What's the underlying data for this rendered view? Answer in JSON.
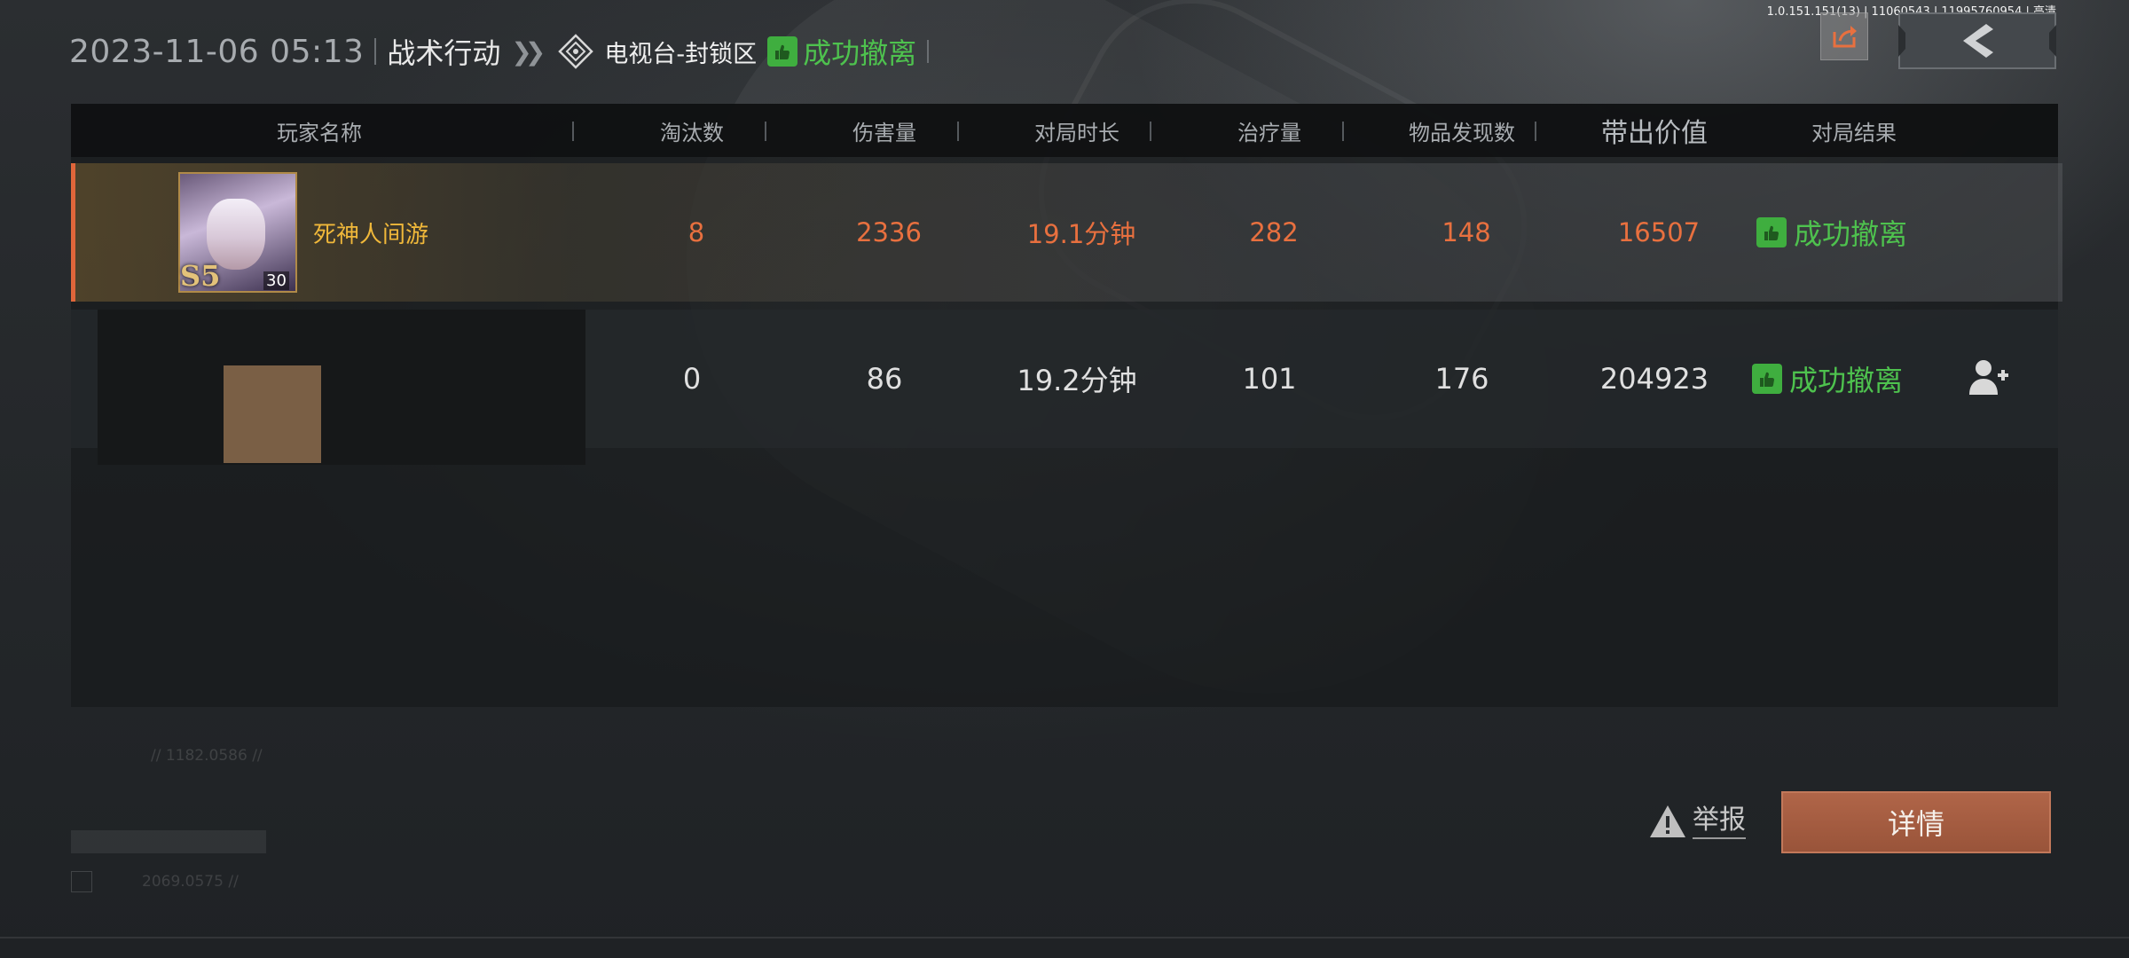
{
  "header": {
    "datetime": "2023-11-06 05:13",
    "mode": "战术行动",
    "map_name": "电视台-封锁区",
    "result": "成功撤离"
  },
  "debug_info": "1.0.151.151(13) | 11060543 | 11995760954 | 高清",
  "table": {
    "columns": [
      "玩家名称",
      "淘汰数",
      "伤害量",
      "对局时长",
      "治疗量",
      "物品发现数",
      "带出价值",
      "对局结果"
    ],
    "rows": [
      {
        "player_name": "死神人间游",
        "rank": "S5",
        "level": "30",
        "eliminations": "8",
        "damage": "2336",
        "duration": "19.1分钟",
        "healing": "282",
        "items_found": "148",
        "extract_value": "16507",
        "result": "成功撤离"
      },
      {
        "player_name": "",
        "eliminations": "0",
        "damage": "86",
        "duration": "19.2分钟",
        "healing": "101",
        "items_found": "176",
        "extract_value": "204923",
        "result": "成功撤离"
      }
    ]
  },
  "faint": {
    "line1": "// 1182.0586 //",
    "line2": "2069.0575 //"
  },
  "actions": {
    "report": "举报",
    "detail": "详情"
  },
  "colors": {
    "success": "#4ec24e",
    "highlight": "#e8703f",
    "player_name": "#f0b83a",
    "detail_button": "#a85c40"
  },
  "icons": {
    "share": "share-icon",
    "back": "back-arrow-icon",
    "map": "map-location-icon",
    "result": "thumbs-up-icon",
    "add_friend": "add-friend-icon",
    "warning": "warning-icon"
  }
}
